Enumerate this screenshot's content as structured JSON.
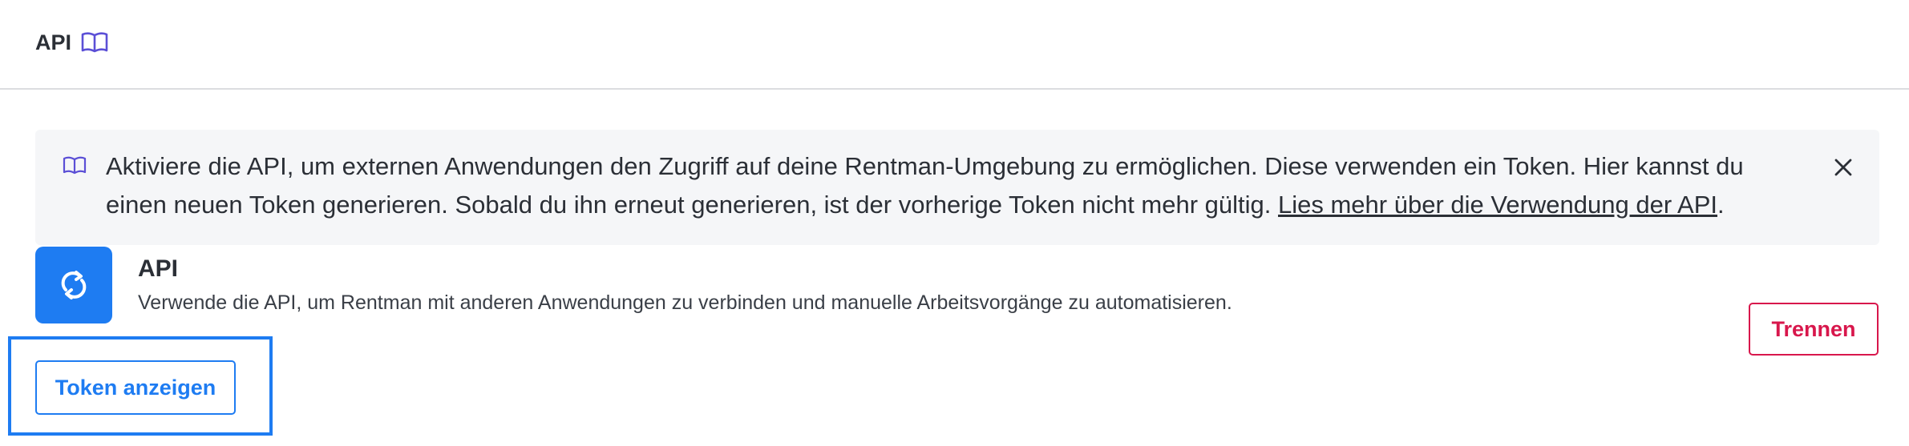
{
  "header": {
    "title": "API",
    "icon": "book-icon",
    "icon_color": "#5b4fd6"
  },
  "banner": {
    "icon": "book-icon",
    "text": "Aktiviere die API, um externen Anwendungen den Zugriff auf deine Rentman-Umgebung zu ermöglichen. Diese verwenden ein Token. Hier kannst du einen neuen Token generieren. Sobald du ihn erneut generieren, ist der vorherige Token nicht mehr gültig. ",
    "link_text": "Lies mehr über die Verwendung der API",
    "suffix": ".",
    "close_icon": "close-icon"
  },
  "integration": {
    "icon": "sync-icon",
    "icon_bg": "#1e7cf2",
    "title": "API",
    "description": "Verwende die API, um Rentman mit anderen Anwendungen zu verbinden und manuelle Arbeitsvorgänge zu automatisieren.",
    "disconnect_label": "Trennen",
    "disconnect_color": "#d8174c"
  },
  "token": {
    "button_label": "Token anzeigen",
    "accent": "#1e7cf2"
  }
}
